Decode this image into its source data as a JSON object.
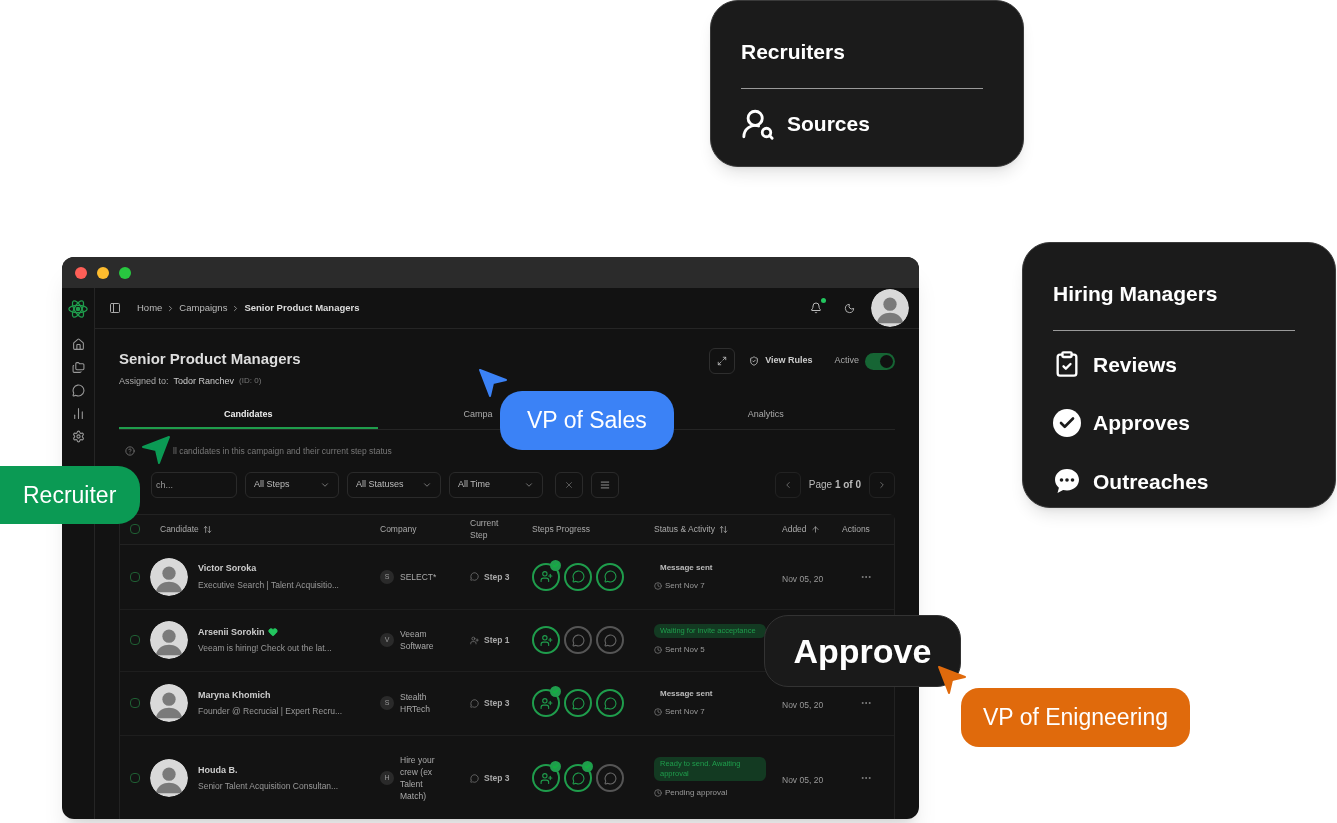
{
  "recruiters_card": {
    "title": "Recruiters",
    "items": [
      {
        "kind": "sources",
        "label": "Sources"
      }
    ]
  },
  "hiring_managers_card": {
    "title": "Hiring Managers",
    "items": [
      {
        "kind": "reviews",
        "label": "Reviews"
      },
      {
        "kind": "approves",
        "label": "Approves"
      },
      {
        "kind": "outreaches",
        "label": "Outreaches"
      }
    ]
  },
  "app": {
    "breadcrumb": [
      "Home",
      "Campaigns",
      "Senior Product Managers"
    ],
    "unread": true,
    "title": "Senior Product Managers",
    "assigned_label": "Assigned to:",
    "assignee": "Todor Ranchev",
    "id": "(ID: 0)",
    "view_rules": "View Rules",
    "active_label": "Active",
    "active": true,
    "tabs": [
      {
        "label": "Candidates",
        "selected": true
      },
      {
        "label": "Campa",
        "selected": false
      },
      {
        "label": "Analytics",
        "selected": false
      }
    ],
    "hint": "ll candidates in this campaign and their current step status",
    "search": {
      "placeholder": "ch..."
    },
    "filters": [
      "All Steps",
      "All Statuses",
      "All Time"
    ],
    "pagination": "Page **1 of 0**",
    "all_checked": false,
    "columns": [
      {
        "label": "Candidate",
        "sortable": true
      },
      {
        "label": "Company"
      },
      {
        "label": "Current Step"
      },
      {
        "label": "Steps Progress"
      },
      {
        "label": "Status & Activity",
        "sortable": true
      },
      {
        "label": "Added",
        "sorted_ascending": true
      },
      {
        "label": "Actions"
      }
    ],
    "rows": [
      {
        "checked": false,
        "name": "Victor Soroka",
        "headline": "Executive Search | Talent Acquisitio...",
        "heart": false,
        "company": {
          "initial": "S",
          "name": "SELECT*"
        },
        "current": {
          "kind": "message",
          "label": "Step 3"
        },
        "steps": [
          {
            "kind": "invite",
            "done": true,
            "badge": true
          },
          {
            "kind": "message",
            "done": true,
            "badge": false
          },
          {
            "kind": "message",
            "done": true,
            "badge": false
          }
        ],
        "status": {
          "kind": "plain",
          "label": "Message sent"
        },
        "activity": "Sent Nov 7",
        "added": "Nov 05, 20",
        "menu": true
      },
      {
        "checked": false,
        "name": "Arsenii Sorokin",
        "headline": "Veeam is hiring! Check out the lat...",
        "heart": true,
        "company": {
          "initial": "V",
          "name": "Veeam Software"
        },
        "current": {
          "kind": "invite",
          "label": "Step 1"
        },
        "steps": [
          {
            "kind": "invite",
            "done": true,
            "badge": false
          },
          {
            "kind": "message",
            "done": false,
            "badge": false
          },
          {
            "kind": "message",
            "done": false,
            "badge": false
          }
        ],
        "status": {
          "kind": "pill",
          "label": "Waiting for invite acceptance"
        },
        "activity": "Sent Nov 5",
        "menu": false
      },
      {
        "checked": false,
        "name": "Maryna Khomich",
        "headline": "Founder @ Recrucial | Expert Recru...",
        "heart": false,
        "company": {
          "initial": "S",
          "name": "Stealth HRTech"
        },
        "current": {
          "kind": "message",
          "label": "Step 3"
        },
        "steps": [
          {
            "kind": "invite",
            "done": true,
            "badge": true
          },
          {
            "kind": "message",
            "done": true,
            "badge": false
          },
          {
            "kind": "message",
            "done": true,
            "badge": false
          }
        ],
        "status": {
          "kind": "plain",
          "label": "Message sent"
        },
        "activity": "Sent Nov 7",
        "added": "Nov 05, 20",
        "menu": true
      },
      {
        "checked": false,
        "name": "Houda B.",
        "headline": "Senior Talent Acquisition Consultan...",
        "heart": false,
        "company": {
          "initial": "H",
          "name": "Hire your crew (ex Talent Match)"
        },
        "current": {
          "kind": "message",
          "label": "Step 3"
        },
        "steps": [
          {
            "kind": "invite",
            "done": true,
            "badge": true
          },
          {
            "kind": "message",
            "done": true,
            "badge": true
          },
          {
            "kind": "message",
            "done": false,
            "badge": false
          }
        ],
        "status": {
          "kind": "pill",
          "label": "Ready to send. Awaiting approval"
        },
        "activity": "Pending approval",
        "added": "Nov 05, 20",
        "menu": true
      }
    ]
  },
  "approve_card": {
    "label": "Approve"
  },
  "badges": [
    {
      "label": "Recruiter",
      "color": "#0b9a54"
    },
    {
      "label": "VP of Sales",
      "color": "#3b82f6"
    },
    {
      "label": "VP of Enigneering",
      "color": "#e06a0c"
    }
  ]
}
